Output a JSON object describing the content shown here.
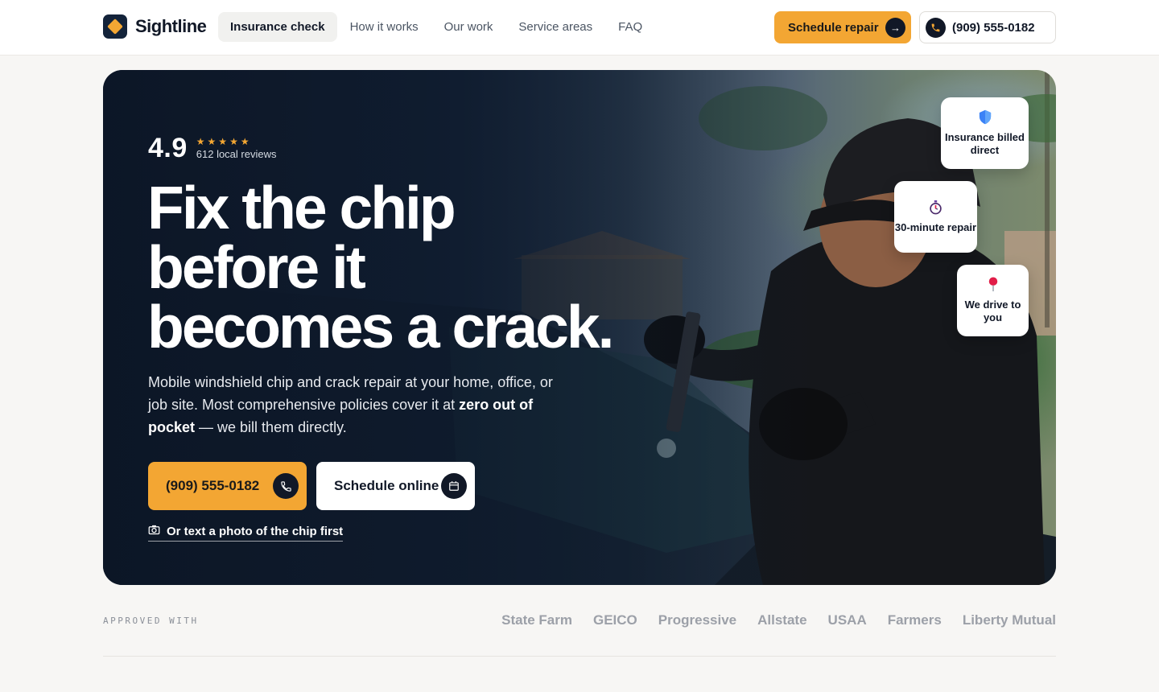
{
  "brand": {
    "name": "Sightline",
    "accent": "#f3a633",
    "dark": "#111827"
  },
  "nav": {
    "links": [
      "Insurance check",
      "How it works",
      "Our work",
      "Service areas",
      "FAQ"
    ],
    "active_index": 0,
    "schedule_label": "Schedule repair",
    "phone": "(909) 555-0182"
  },
  "hero": {
    "rating": {
      "score": "4.9",
      "stars": 5,
      "reviews": "612 local reviews"
    },
    "headline": [
      "Fix the chip",
      "before it",
      "becomes a crack."
    ],
    "subtitle": {
      "pre": "Mobile windshield chip and crack repair at your home, office, or job site. Most comprehensive policies cover it at ",
      "bold": "zero out of pocket",
      "post": " — we bill them directly."
    },
    "cta_phone": "(909) 555-0182",
    "cta_schedule": "Schedule online",
    "text_photo": "Or text a photo of the chip first",
    "badges": [
      {
        "icon": "shield-icon",
        "label": "Insurance billed direct"
      },
      {
        "icon": "stopwatch-icon",
        "label": "30-minute repair"
      },
      {
        "icon": "pin-icon",
        "label": "We drive to you"
      }
    ]
  },
  "approved": {
    "label": "APPROVED WITH",
    "insurers": [
      "State Farm",
      "GEICO",
      "Progressive",
      "Allstate",
      "USAA",
      "Farmers",
      "Liberty Mutual"
    ]
  }
}
